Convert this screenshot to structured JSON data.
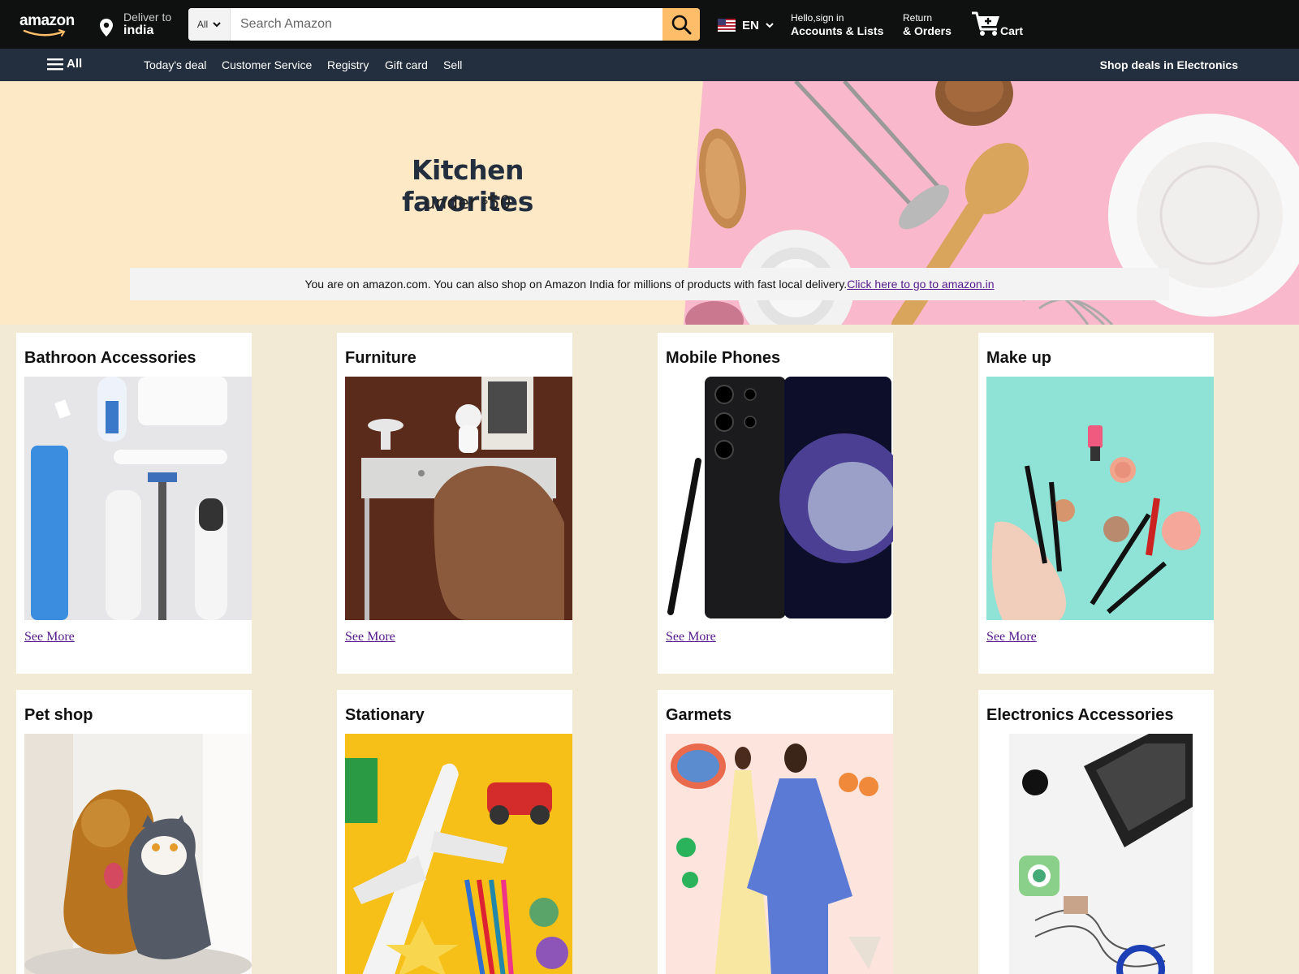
{
  "header": {
    "logo_text": "amazon",
    "deliver_label": "Deliver to",
    "deliver_location": "india",
    "search_category": "All",
    "search_placeholder": "Search Amazon",
    "language": "EN",
    "account_greeting": "Hello,sign in",
    "account_label": "Accounts & Lists",
    "returns_label": "Return",
    "orders_label": "& Orders",
    "cart_label": "Cart",
    "brand_color": "#febd69"
  },
  "subnav": {
    "all_label": "All",
    "links": [
      "Today's deal",
      "Customer Service",
      "Registry",
      "Gift card",
      "Sell"
    ],
    "deals_label": "Shop deals in Electronics"
  },
  "hero": {
    "title": "Kitchen favorites",
    "subtitle_prefix": "under ",
    "subtitle_currency": "$",
    "subtitle_amount": "50",
    "notice_text": "You are on amazon.com. You can also shop on Amazon India for millions of products with fast local delivery.",
    "notice_link": "Click here to go to amazon.in"
  },
  "cards": [
    {
      "title": "Bathroon Accessories",
      "link": "See More"
    },
    {
      "title": "Furniture",
      "link": "See More"
    },
    {
      "title": "Mobile Phones",
      "link": "See More"
    },
    {
      "title": "Make up",
      "link": "See More"
    },
    {
      "title": "Pet shop",
      "link": "See More"
    },
    {
      "title": "Stationary",
      "link": "See More"
    },
    {
      "title": "Garmets",
      "link": "See More"
    },
    {
      "title": "Electronics Accessories",
      "link": "See More"
    }
  ]
}
